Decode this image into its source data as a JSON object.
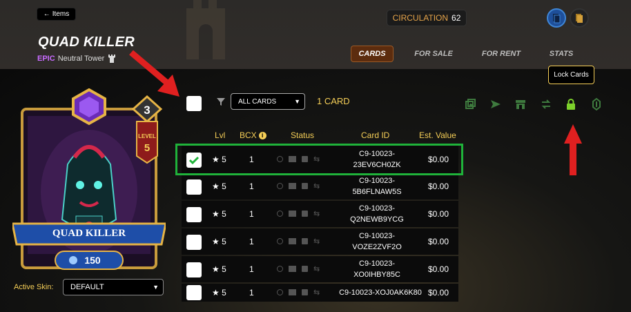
{
  "header": {
    "back_label": "Items",
    "title": "QUAD KILLER",
    "rarity": "EPIC",
    "type_text": "Neutral Tower",
    "circulation_label": "CIRCULATION",
    "circulation_value": "62"
  },
  "tabs": [
    {
      "label": "CARDS",
      "active": true
    },
    {
      "label": "FOR SALE",
      "active": false
    },
    {
      "label": "FOR RENT",
      "active": false
    },
    {
      "label": "STATS",
      "active": false
    }
  ],
  "tooltip": "Lock Cards",
  "card": {
    "name": "QUAD KILLER",
    "level_label": "LEVEL",
    "level": "5",
    "mana_top": "3",
    "cost": "150"
  },
  "skin": {
    "label": "Active Skin:",
    "selected": "DEFAULT"
  },
  "filter": {
    "selected": "ALL CARDS",
    "count_text": "1 CARD"
  },
  "table": {
    "headers": [
      "Lvl",
      "BCX",
      "Status",
      "Card ID",
      "Est. Value"
    ],
    "rows": [
      {
        "lvl": "★ 5",
        "bcx": "1",
        "card_id": "C9-10023-\n23EV6CH0ZK",
        "value": "$0.00",
        "checked": true
      },
      {
        "lvl": "★ 5",
        "bcx": "1",
        "card_id": "C9-10023-\n5B6FLNAW5S",
        "value": "$0.00",
        "checked": false
      },
      {
        "lvl": "★ 5",
        "bcx": "1",
        "card_id": "C9-10023-\nQ2NEWB9YCG",
        "value": "$0.00",
        "checked": false
      },
      {
        "lvl": "★ 5",
        "bcx": "1",
        "card_id": "C9-10023-\nVOZE2ZVF2O",
        "value": "$0.00",
        "checked": false
      },
      {
        "lvl": "★ 5",
        "bcx": "1",
        "card_id": "C9-10023-\nXO0IHBY85C",
        "value": "$0.00",
        "checked": false
      },
      {
        "lvl": "★ 5",
        "bcx": "1",
        "card_id": "C9-10023-XOJ0AK6K80",
        "value": "$0.00",
        "checked": false
      }
    ]
  },
  "colors": {
    "accent": "#f6cf57",
    "lock_green": "#7dd12b",
    "highlight_green": "#1fb33a",
    "arrow_red": "#e02020"
  },
  "icons": [
    "back-arrow-icon",
    "tower-icon",
    "filter-icon",
    "combine-icon",
    "send-icon",
    "market-icon",
    "transfer-icon",
    "lock-icon",
    "burn-icon",
    "clock-icon",
    "lock-status-icon",
    "info-icon"
  ]
}
